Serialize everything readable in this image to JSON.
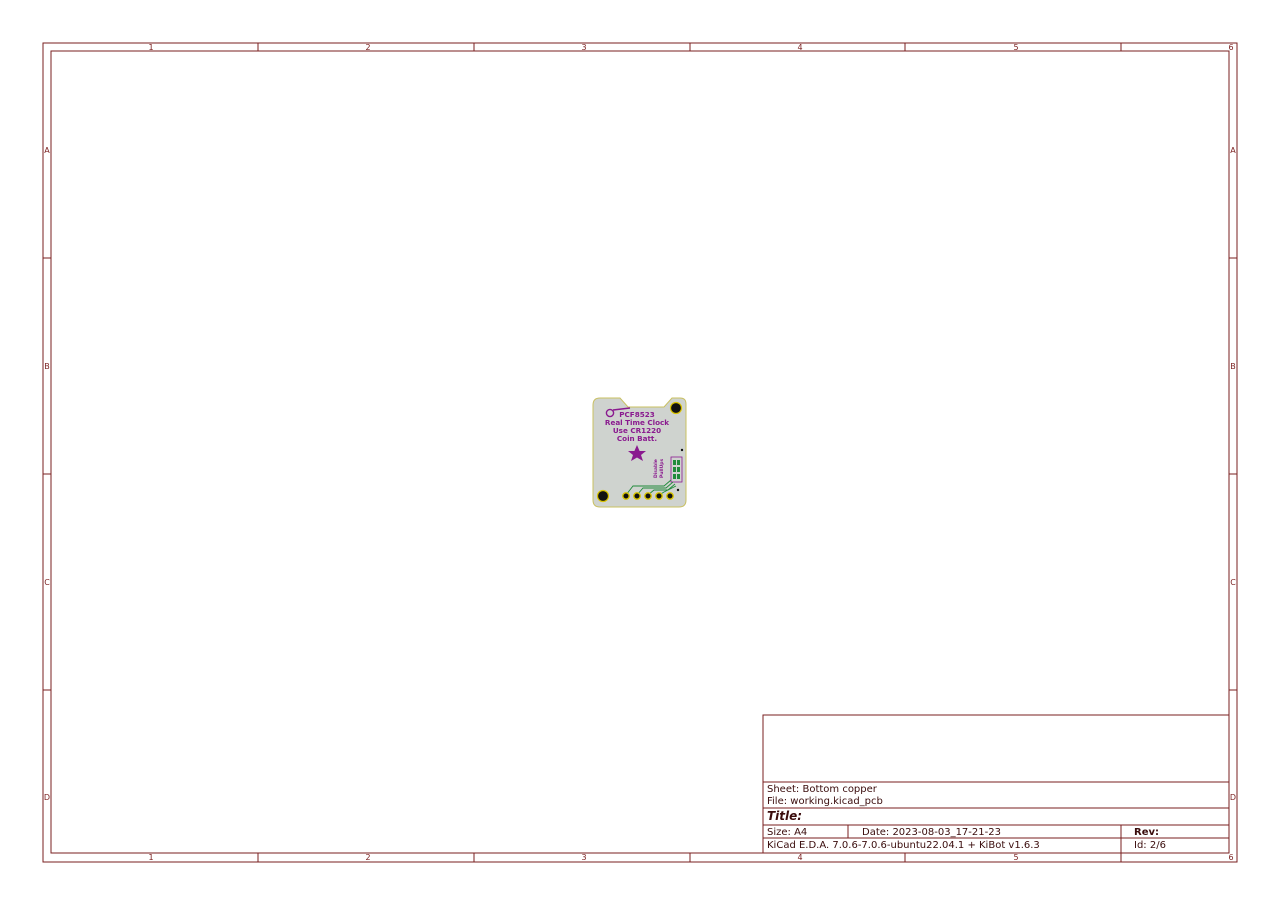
{
  "frame": {
    "columns": [
      "1",
      "2",
      "3",
      "4",
      "5",
      "6"
    ],
    "rows": [
      "A",
      "B",
      "C",
      "D"
    ]
  },
  "board": {
    "silk_lines": [
      "PCF8523",
      "Real Time Clock",
      "Use CR1220",
      "Coin Batt."
    ],
    "small_marks": [
      "Disable",
      "PullUps"
    ]
  },
  "title_block": {
    "sheet": "Sheet: Bottom copper",
    "file": "File: working.kicad_pcb",
    "title": "Title:",
    "size": "Size: A4",
    "date": "Date: 2023-08-03_17-21-23",
    "rev": "Rev:",
    "tool": "KiCad E.D.A. 7.0.6-7.0.6-ubuntu22.04.1 + KiBot v1.6.3",
    "id": "Id: 2/6"
  },
  "colors": {
    "frame": "#7a1f1f",
    "board": "#cfd3cf",
    "silkscreen": "#8a1a8f",
    "pad": "#d8c200",
    "copper": "#1f8a3a"
  }
}
